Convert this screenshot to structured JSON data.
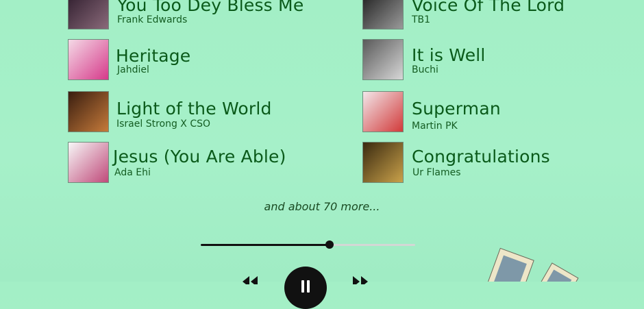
{
  "tracks": [
    {
      "title": "You Too Dey Bless Me",
      "artist": "Frank Edwards",
      "cover_icon": "album-art-icon",
      "colors": [
        "#2b1a2a",
        "#8a6a7a"
      ]
    },
    {
      "title": "Voice Of The Lord",
      "artist": "TB1",
      "cover_icon": "album-art-icon",
      "colors": [
        "#1a1a1a",
        "#9a9a9a"
      ]
    },
    {
      "title": "Heritage",
      "artist": "Jahdiel",
      "cover_icon": "album-art-icon",
      "colors": [
        "#f4d9e6",
        "#d63a8a"
      ]
    },
    {
      "title": "It is Well",
      "artist": "Buchi",
      "cover_icon": "album-art-icon",
      "colors": [
        "#5a5a5a",
        "#d7d7d7"
      ]
    },
    {
      "title": "Light of the World",
      "artist": "Israel Strong X CSO",
      "cover_icon": "album-art-icon",
      "colors": [
        "#3a1e10",
        "#c57a3a"
      ]
    },
    {
      "title": "Superman",
      "artist": "Martin PK",
      "cover_icon": "album-art-icon",
      "colors": [
        "#f2e7ea",
        "#d23a3a"
      ]
    },
    {
      "title": "Jesus (You Are Able)",
      "artist": "Ada Ehi",
      "cover_icon": "album-art-icon",
      "colors": [
        "#f7f7f7",
        "#c04a7a"
      ]
    },
    {
      "title": "Congratulations",
      "artist": "Ur Flames",
      "cover_icon": "album-art-icon",
      "colors": [
        "#3a2a10",
        "#c9a14a"
      ]
    }
  ],
  "more_text": "and about 70 more...",
  "player": {
    "progress": 0.6,
    "track_color": "#d3d7d5",
    "fill_color": "#111111"
  },
  "controls": {
    "previous_icon": "previous-icon",
    "play_pause_icon": "pause-icon",
    "next_icon": "next-icon"
  },
  "decor_icon": "photo-frames-icon",
  "colors": {
    "background": "#a3efc6",
    "title": "#0a5a1a",
    "artist": "#145d22"
  }
}
